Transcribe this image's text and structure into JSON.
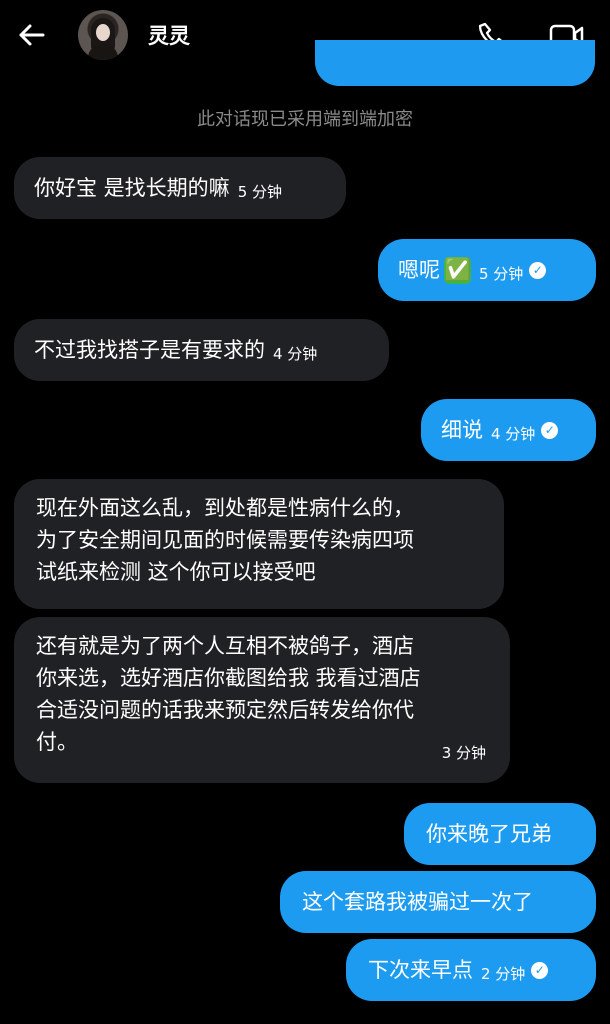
{
  "header": {
    "title": "灵灵",
    "icons": [
      "back-arrow-icon",
      "avatar",
      "phone-icon",
      "video-icon"
    ]
  },
  "notice": "此对话现已采用端到端加密",
  "messages": [
    {
      "side": "in",
      "text": "你好宝 是找长期的嘛",
      "time": "5 分钟"
    },
    {
      "side": "out",
      "text": "嗯呢",
      "emoji": "✅",
      "time": "5 分钟",
      "read": true
    },
    {
      "side": "in",
      "text": "不过我找搭子是有要求的",
      "time": "4 分钟"
    },
    {
      "side": "out",
      "text": "细说",
      "time": "4 分钟",
      "read": true
    },
    {
      "side": "in",
      "lines": [
        "现在外面这么乱，到处都是性病什么的，",
        "为了安全期间见面的时候需要传染病四项",
        "试纸来检测 这个你可以接受吧"
      ]
    },
    {
      "side": "in",
      "lines": [
        "还有就是为了两个人互相不被鸽子，酒店",
        "你来选，选好酒店你截图给我 我看过酒店",
        "合适没问题的话我来预定然后转发给你代",
        "付。"
      ],
      "time": "3 分钟"
    },
    {
      "side": "out",
      "text": "你来晚了兄弟"
    },
    {
      "side": "out",
      "text": "这个套路我被骗过一次了"
    },
    {
      "side": "out",
      "text": "下次来早点",
      "time": "2 分钟",
      "read": true
    }
  ],
  "colors": {
    "outgoing": "#1d9bf0",
    "incoming": "#202124",
    "background": "#000000"
  }
}
